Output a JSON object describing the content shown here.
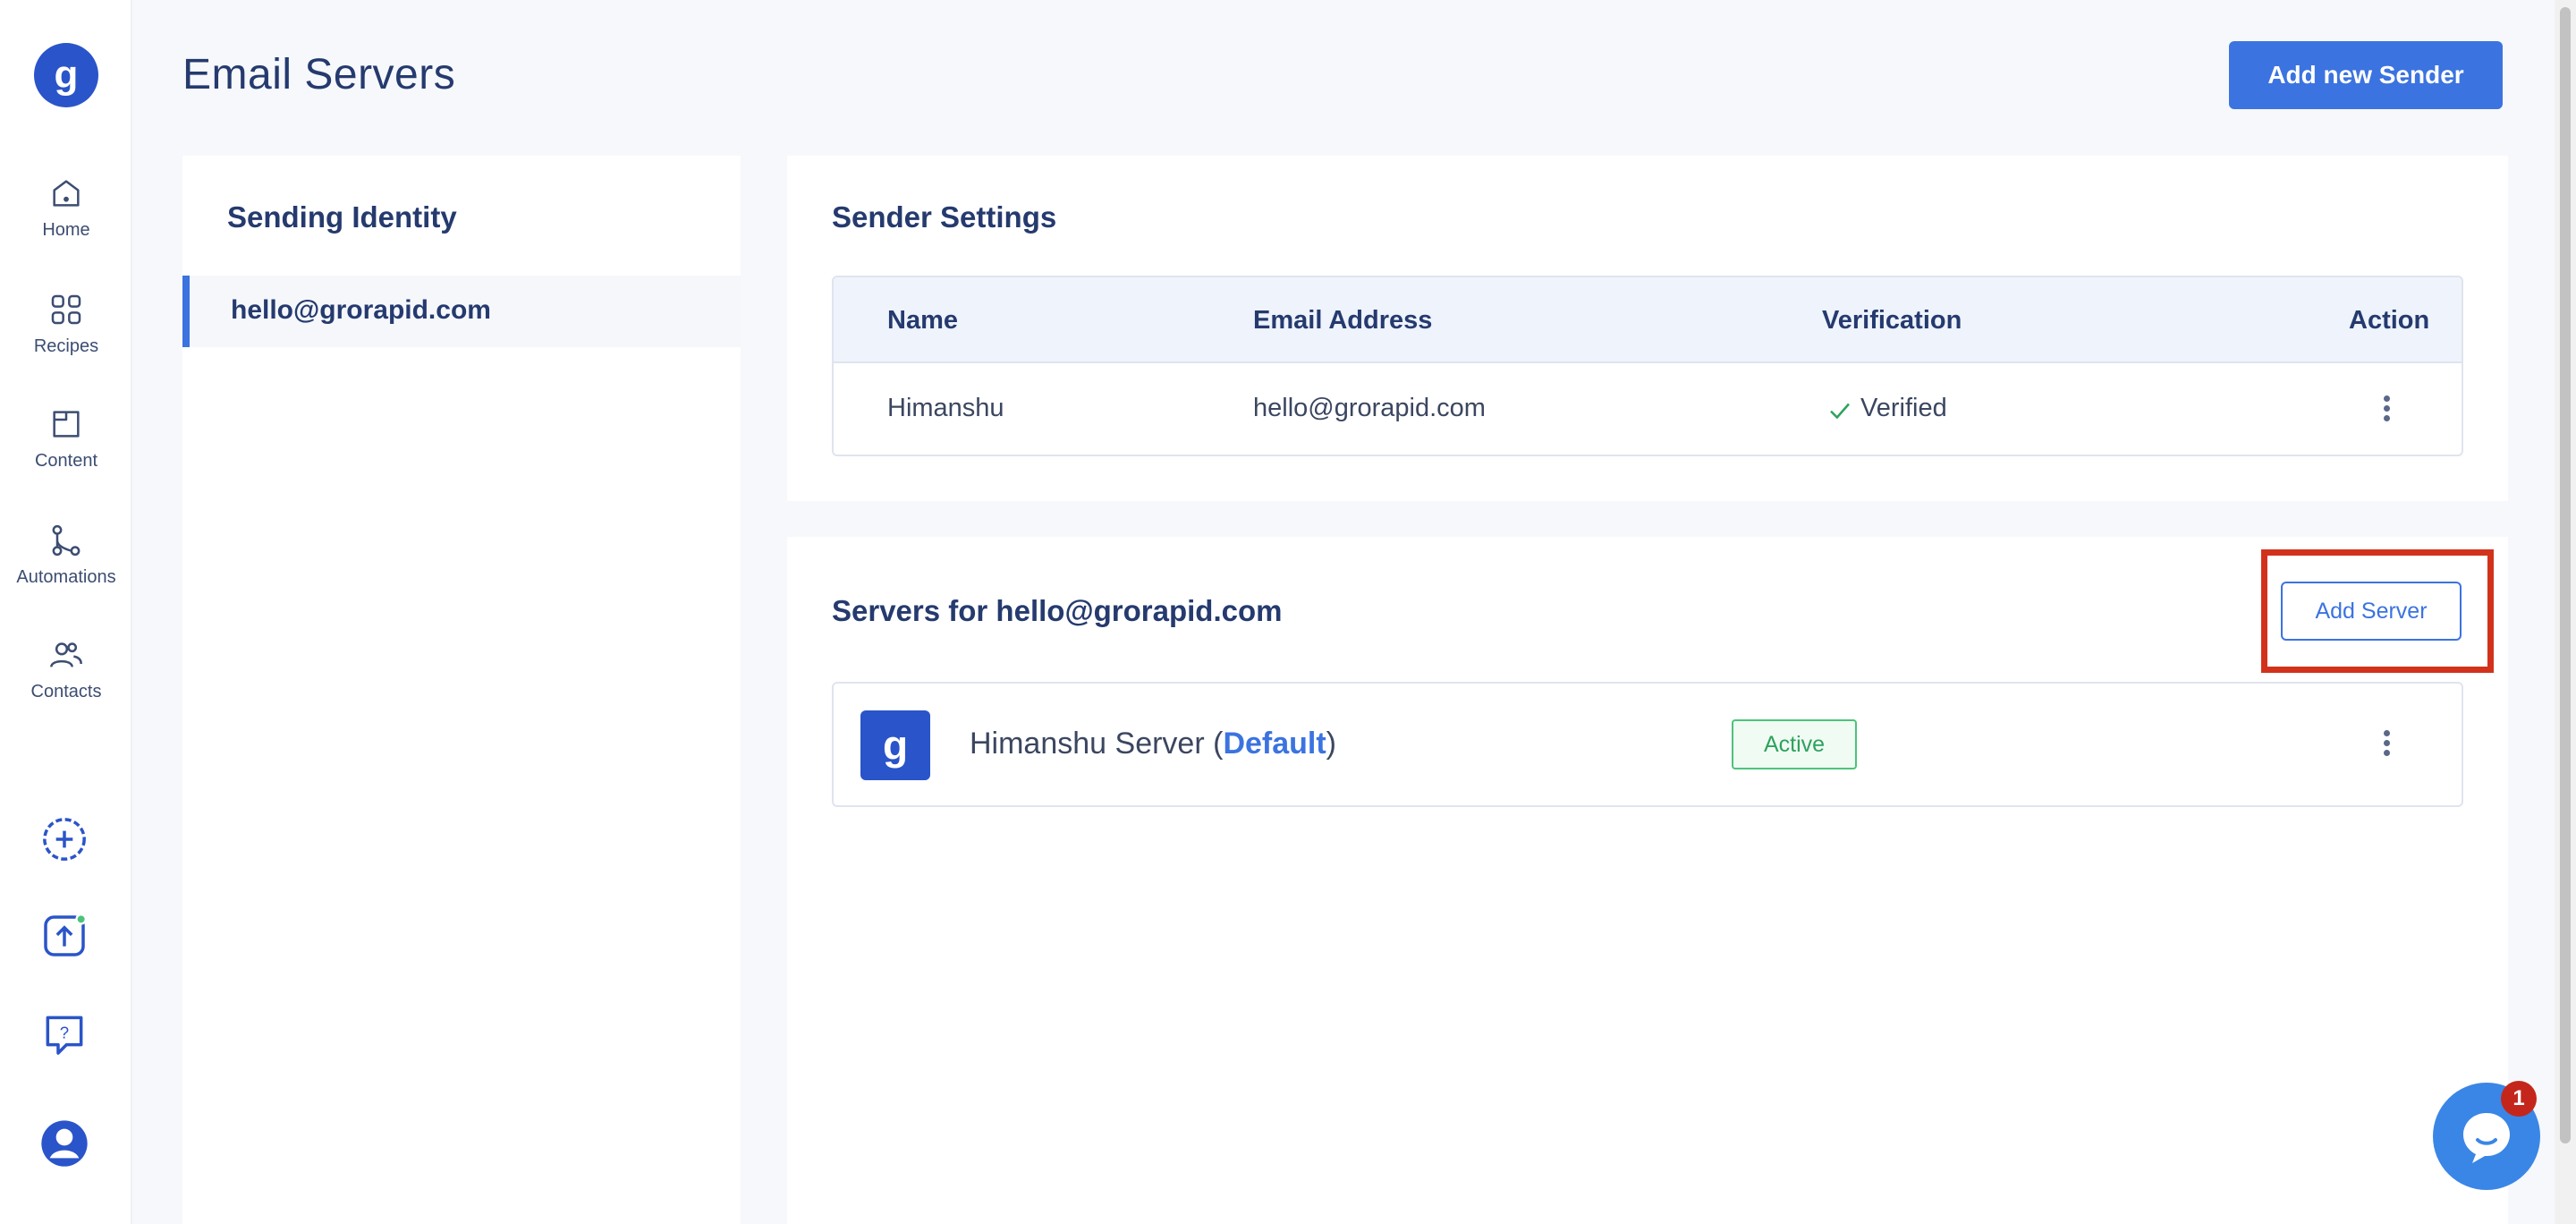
{
  "nav": {
    "logo_letter": "g",
    "items": [
      {
        "label": "Home",
        "icon": "home-icon"
      },
      {
        "label": "Recipes",
        "icon": "grid-icon"
      },
      {
        "label": "Content",
        "icon": "folder-icon"
      },
      {
        "label": "Automations",
        "icon": "flow-icon"
      },
      {
        "label": "Contacts",
        "icon": "users-icon"
      }
    ],
    "bottom_icons": [
      "add-circle-icon",
      "upload-icon",
      "help-chat-icon",
      "user-avatar-icon"
    ]
  },
  "header": {
    "title": "Email Servers",
    "add_sender_label": "Add new Sender"
  },
  "identity": {
    "title": "Sending Identity",
    "items": [
      "hello@grorapid.com"
    ]
  },
  "sender_settings": {
    "title": "Sender Settings",
    "columns": [
      "Name",
      "Email Address",
      "Verification",
      "Action"
    ],
    "rows": [
      {
        "name": "Himanshu",
        "email": "hello@grorapid.com",
        "verification": "Verified"
      }
    ]
  },
  "servers": {
    "title": "Servers for hello@grorapid.com",
    "add_server_label": "Add Server",
    "items": [
      {
        "logo_letter": "g",
        "name": "Himanshu Server",
        "default_label": "Default",
        "status": "Active"
      }
    ]
  },
  "chat": {
    "badge_count": "1"
  },
  "colors": {
    "accent": "#3b73e0",
    "brand": "#2a54c9",
    "highlight": "#d2321c",
    "success": "#2ea25d"
  }
}
